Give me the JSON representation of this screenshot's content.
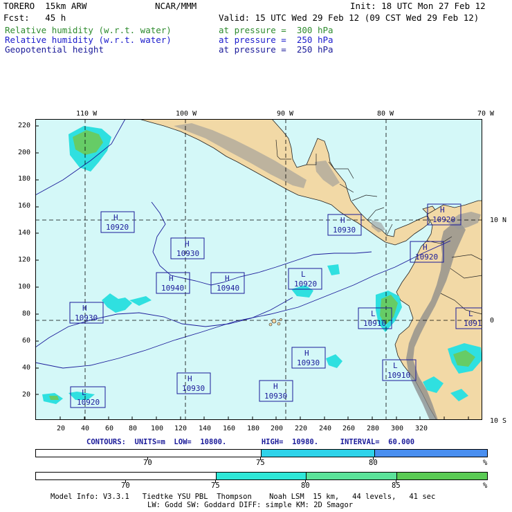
{
  "header": {
    "model": "TORERO  15km ARW",
    "org": "NCAR/MMM",
    "init": "Init: 18 UTC Mon 27 Feb 12",
    "fcst": "Fcst:   45 h",
    "valid": "Valid: 15 UTC Wed 29 Feb 12 (09 CST Wed 29 Feb 12)",
    "fields": [
      {
        "name": "Relative humidity (w.r.t. water)",
        "level": "at pressure =  300 hPa",
        "color": "#2e8b2e"
      },
      {
        "name": "Relative humidity (w.r.t. water)",
        "level": "at pressure =  250 hPa",
        "color": "#1a1acc"
      },
      {
        "name": "Geopotential height",
        "level": "at pressure =  250 hPa",
        "color": "#1a1a99"
      }
    ]
  },
  "map": {
    "colors": {
      "ocean": "#d4f8f8",
      "land": "#f2d9a6",
      "rh_cyan": "#2fe0e0",
      "rh_green": "#66cc66",
      "terrain": "#8a8a8a",
      "grid": "#000000",
      "contour": "#1a1a99"
    },
    "lon_labels": [
      "110 W",
      "100 W",
      "90 W",
      "80 W",
      "70 W"
    ],
    "lat_labels": [
      "10 N",
      "0",
      "10 S"
    ],
    "x_ticks": [
      "20",
      "40",
      "60",
      "80",
      "100",
      "120",
      "140",
      "160",
      "180",
      "200",
      "220",
      "240",
      "260",
      "280",
      "300",
      "320"
    ],
    "y_ticks": [
      "220",
      "200",
      "180",
      "160",
      "140",
      "120",
      "100",
      "80",
      "60",
      "40",
      "20"
    ],
    "centers": [
      {
        "type": "H",
        "value": "10920"
      },
      {
        "type": "H",
        "value": "10930"
      },
      {
        "type": "H",
        "value": "10940"
      },
      {
        "type": "H",
        "value": "10940"
      },
      {
        "type": "L",
        "value": "10920"
      },
      {
        "type": "H",
        "value": "10930"
      },
      {
        "type": "H",
        "value": "10920"
      },
      {
        "type": "H",
        "value": "10920"
      },
      {
        "type": "H",
        "value": "10930"
      },
      {
        "type": "L",
        "value": "10910"
      },
      {
        "type": "L",
        "value": "1091"
      },
      {
        "type": "H",
        "value": "10930"
      },
      {
        "type": "L",
        "value": "10910"
      },
      {
        "type": "H",
        "value": "10930"
      },
      {
        "type": "H",
        "value": "10930"
      },
      {
        "type": "L",
        "value": "10920"
      }
    ]
  },
  "contours": {
    "text": "CONTOURS:  UNITS=m  LOW=  10800.        HIGH=  10980.     INTERVAL=  60.000"
  },
  "colorbars": [
    {
      "labels": [
        "70",
        "75",
        "80"
      ],
      "unit": "%",
      "colors": [
        "#ffffff",
        "#2fd3ea",
        "#4a8ff0"
      ]
    },
    {
      "labels": [
        "70",
        "75",
        "80",
        "85"
      ],
      "unit": "%",
      "colors": [
        "#ffffff",
        "#2fe8d8",
        "#5be39a",
        "#5acb54"
      ]
    }
  ],
  "footer": {
    "line1": "Model Info: V3.3.1   Tiedtke YSU PBL  Thompson    Noah LSM  15 km,   44 levels,   41 sec",
    "line2": "LW: Godd SW: Goddard DIFF: simple KM: 2D Smagor"
  }
}
